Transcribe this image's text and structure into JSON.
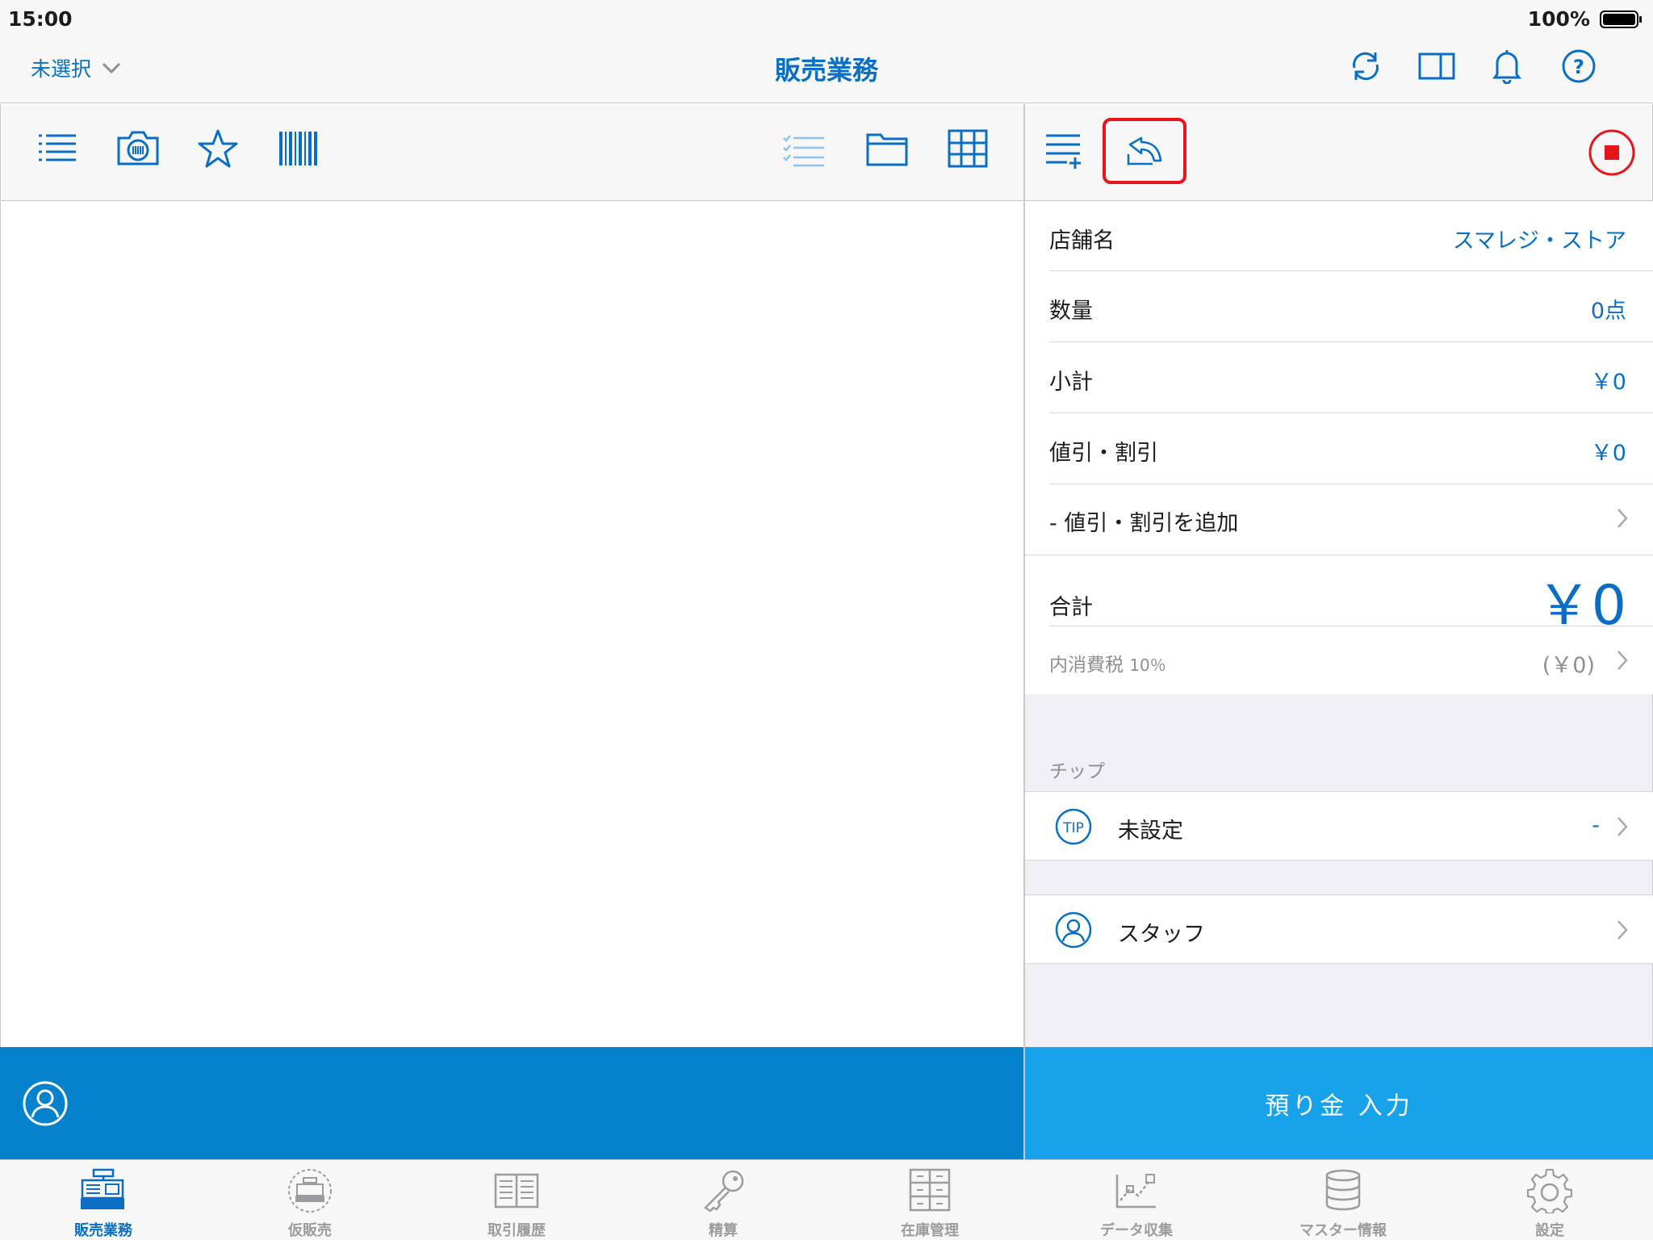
{
  "status_bar": {
    "time": "15:00",
    "battery": "100%"
  },
  "nav": {
    "store_select": "未選択",
    "title": "販売業務",
    "icons": [
      "refresh-icon",
      "split-view-icon",
      "bell-icon",
      "help-icon"
    ]
  },
  "left_toolbar": {
    "icons": [
      "list-icon",
      "camera-barcode-icon",
      "star-icon",
      "barcode-icon",
      "checklist-icon",
      "folder-icon",
      "grid-icon"
    ]
  },
  "right_toolbar": {
    "icons": [
      "add-list-icon",
      "return-icon",
      "stop-icon"
    ],
    "highlight_color": "#e8141b"
  },
  "summary": {
    "store": {
      "label": "店舗名",
      "value": "スマレジ・ストア"
    },
    "quantity": {
      "label": "数量",
      "value": "0点"
    },
    "subtotal": {
      "label": "小計",
      "value": "￥0"
    },
    "discount": {
      "label": "値引・割引",
      "value": "￥0"
    },
    "add_discount": {
      "label": "- 値引・割引を追加"
    },
    "total": {
      "label": "合計",
      "value": "￥0"
    },
    "tax": {
      "label": "内消費税",
      "rate": "10％",
      "value": "(￥0)"
    },
    "tip_section": "チップ",
    "tip": {
      "icon_text": "TIP",
      "label": "未設定",
      "value": "-"
    },
    "staff": {
      "label": "スタッフ"
    }
  },
  "deposit_button": "預り金 入力",
  "tabs": [
    {
      "label": "販売業務",
      "icon": "register-icon",
      "active": true
    },
    {
      "label": "仮販売",
      "icon": "temp-register-icon",
      "active": false
    },
    {
      "label": "取引履歴",
      "icon": "book-icon",
      "active": false
    },
    {
      "label": "精算",
      "icon": "key-icon",
      "active": false
    },
    {
      "label": "在庫管理",
      "icon": "cabinet-icon",
      "active": false
    },
    {
      "label": "データ収集",
      "icon": "data-chart-icon",
      "active": false
    },
    {
      "label": "マスター情報",
      "icon": "database-icon",
      "active": false
    },
    {
      "label": "設定",
      "icon": "gear-icon",
      "active": false
    }
  ],
  "colors": {
    "accent": "#0a6fc4",
    "customer_bar": "#0582cc",
    "deposit": "#17a2ea",
    "stop": "#e8141b"
  }
}
